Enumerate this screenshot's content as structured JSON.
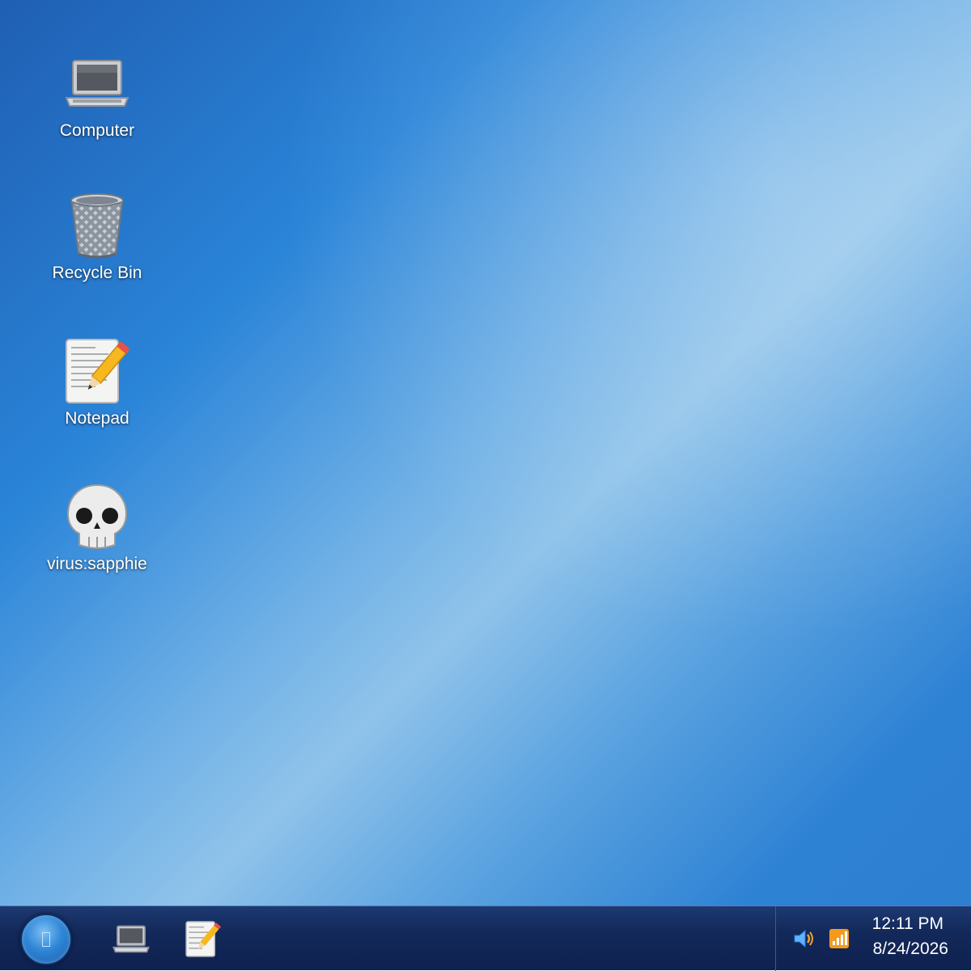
{
  "desktop": {
    "icons": [
      {
        "label": "Computer",
        "icon": "laptop-icon"
      },
      {
        "label": "Recycle Bin",
        "icon": "recycle-bin-icon"
      },
      {
        "label": "Notepad",
        "icon": "notepad-icon"
      },
      {
        "label": "virus:sapphie",
        "icon": "skull-icon"
      }
    ]
  },
  "taskbar": {
    "start_icon": "start-orb-icon",
    "items": [
      {
        "icon": "laptop-icon"
      },
      {
        "icon": "notepad-icon"
      }
    ],
    "tray": {
      "icons": [
        "speaker-icon",
        "signal-icon"
      ],
      "time": "12:11 PM",
      "date": "8/24/2026"
    }
  },
  "colors": {
    "taskbar": "#13295a",
    "desktop_accent": "#2a84d8",
    "label_text": "#ffffff"
  }
}
